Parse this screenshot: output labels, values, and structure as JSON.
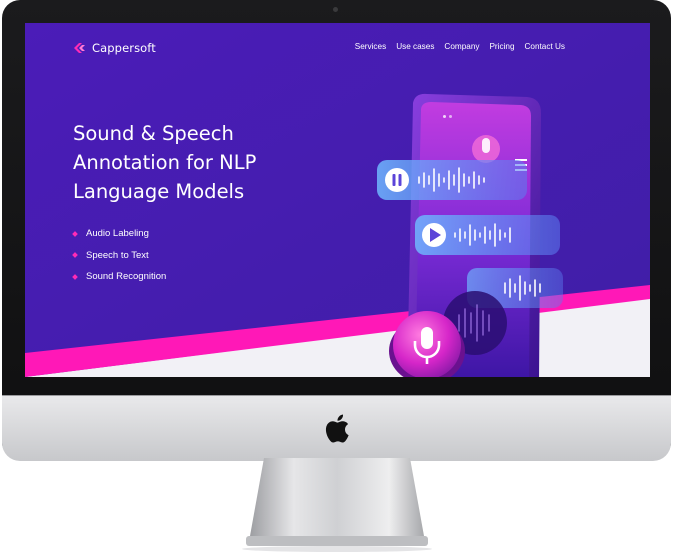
{
  "site": {
    "brand_name": "Cappersoft",
    "nav": [
      "Services",
      "Use cases",
      "Company",
      "Pricing",
      "Contact Us"
    ]
  },
  "hero": {
    "headline_lines": [
      "Sound & Speech",
      "Annotation for NLP",
      "Language Models"
    ],
    "features": [
      "Audio Labeling",
      "Speech to Text",
      "Sound Recognition"
    ]
  },
  "colors": {
    "background": "#4a1fb6",
    "accent_pink": "#ff18b7",
    "text": "#ffffff",
    "bezel": "#111112",
    "chin": "#d8d9db"
  },
  "icons": {
    "brand": "cappersoft-logo-icon",
    "hardware": "apple-logo-icon",
    "phone_controls": [
      "pause-icon",
      "play-icon",
      "microphone-icon",
      "menu-icon"
    ]
  }
}
